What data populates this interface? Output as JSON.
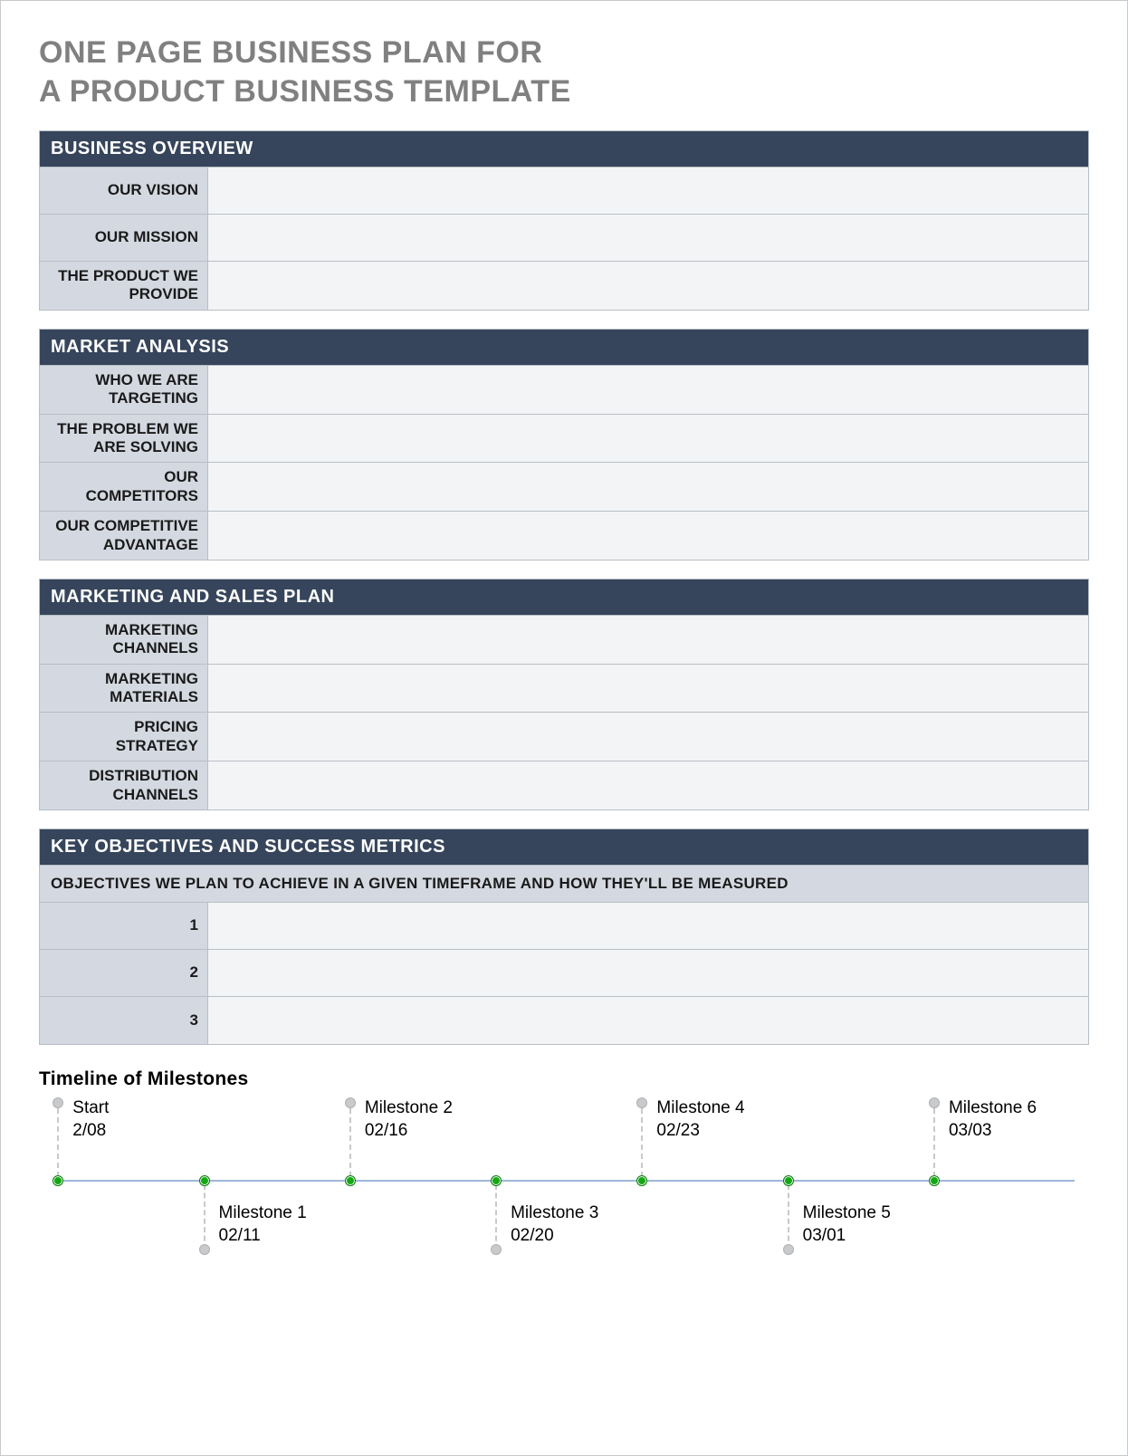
{
  "title": "ONE PAGE BUSINESS PLAN FOR\nA PRODUCT BUSINESS TEMPLATE",
  "sections": {
    "overview": {
      "header": "BUSINESS OVERVIEW",
      "rows": {
        "vision": {
          "label": "OUR VISION",
          "value": ""
        },
        "mission": {
          "label": "OUR MISSION",
          "value": ""
        },
        "product": {
          "label": "THE PRODUCT WE PROVIDE",
          "value": ""
        }
      }
    },
    "market": {
      "header": "MARKET ANALYSIS",
      "rows": {
        "target": {
          "label": "WHO WE ARE TARGETING",
          "value": ""
        },
        "problem": {
          "label": "THE PROBLEM WE ARE SOLVING",
          "value": ""
        },
        "comp": {
          "label": "OUR COMPETITORS",
          "value": ""
        },
        "adv": {
          "label": "OUR COMPETITIVE ADVANTAGE",
          "value": ""
        }
      }
    },
    "marketing": {
      "header": "MARKETING AND SALES PLAN",
      "rows": {
        "channels": {
          "label": "MARKETING CHANNELS",
          "value": ""
        },
        "materials": {
          "label": "MARKETING MATERIALS",
          "value": ""
        },
        "pricing": {
          "label": "PRICING STRATEGY",
          "value": ""
        },
        "dist": {
          "label": "DISTRIBUTION CHANNELS",
          "value": ""
        }
      }
    },
    "objectives": {
      "header": "KEY OBJECTIVES AND SUCCESS METRICS",
      "subheader": "OBJECTIVES WE PLAN TO ACHIEVE IN A GIVEN TIMEFRAME AND HOW THEY'LL BE MEASURED",
      "rows": {
        "o1": {
          "label": "1",
          "value": ""
        },
        "o2": {
          "label": "2",
          "value": ""
        },
        "o3": {
          "label": "3",
          "value": ""
        }
      }
    }
  },
  "timeline": {
    "title": "Timeline of Milestones",
    "items": [
      {
        "name": "Start",
        "date": "2/08",
        "pos": 1.5,
        "side": "above"
      },
      {
        "name": "Milestone 1",
        "date": "02/11",
        "pos": 15.5,
        "side": "below"
      },
      {
        "name": "Milestone 2",
        "date": "02/16",
        "pos": 29.5,
        "side": "above"
      },
      {
        "name": "Milestone 3",
        "date": "02/20",
        "pos": 43.5,
        "side": "below"
      },
      {
        "name": "Milestone 4",
        "date": "02/23",
        "pos": 57.5,
        "side": "above"
      },
      {
        "name": "Milestone 5",
        "date": "03/01",
        "pos": 71.5,
        "side": "below"
      },
      {
        "name": "Milestone 6",
        "date": "03/03",
        "pos": 85.5,
        "side": "above"
      }
    ]
  }
}
